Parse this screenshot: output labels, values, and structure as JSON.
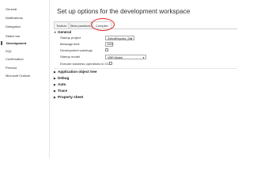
{
  "sidebar": {
    "items": [
      {
        "label": "General"
      },
      {
        "label": "Notifications"
      },
      {
        "label": "Delegation"
      },
      {
        "label": "Status bar"
      },
      {
        "label": "Development"
      },
      {
        "label": "SQL"
      },
      {
        "label": "Confirmation"
      },
      {
        "label": "Preload"
      },
      {
        "label": "Microsoft Outlook"
      }
    ]
  },
  "header": {
    "title": "Set up options for the development workspace"
  },
  "tabs": [
    {
      "label": "Toolbar"
    },
    {
      "label": "Best practices"
    },
    {
      "label": "Compiler"
    }
  ],
  "general": {
    "title": "General",
    "startup_project": {
      "label": "Startup project",
      "value": "ZebraReports_SA"
    },
    "message_limit": {
      "label": "Message limit",
      "value": "1000"
    },
    "development_warnings": {
      "label": "Development warnings"
    },
    "startup_model": {
      "label": "Startup model",
      "value": "VBR Model"
    },
    "execute_business_ops": {
      "label": "Execute business operations in CIL"
    }
  },
  "sections": [
    {
      "label": "Application object tree"
    },
    {
      "label": "Debug"
    },
    {
      "label": "Auto"
    },
    {
      "label": "Trace"
    },
    {
      "label": "Property sheet"
    }
  ],
  "colors": {
    "highlight": "#e02020",
    "accent": "#555555"
  }
}
